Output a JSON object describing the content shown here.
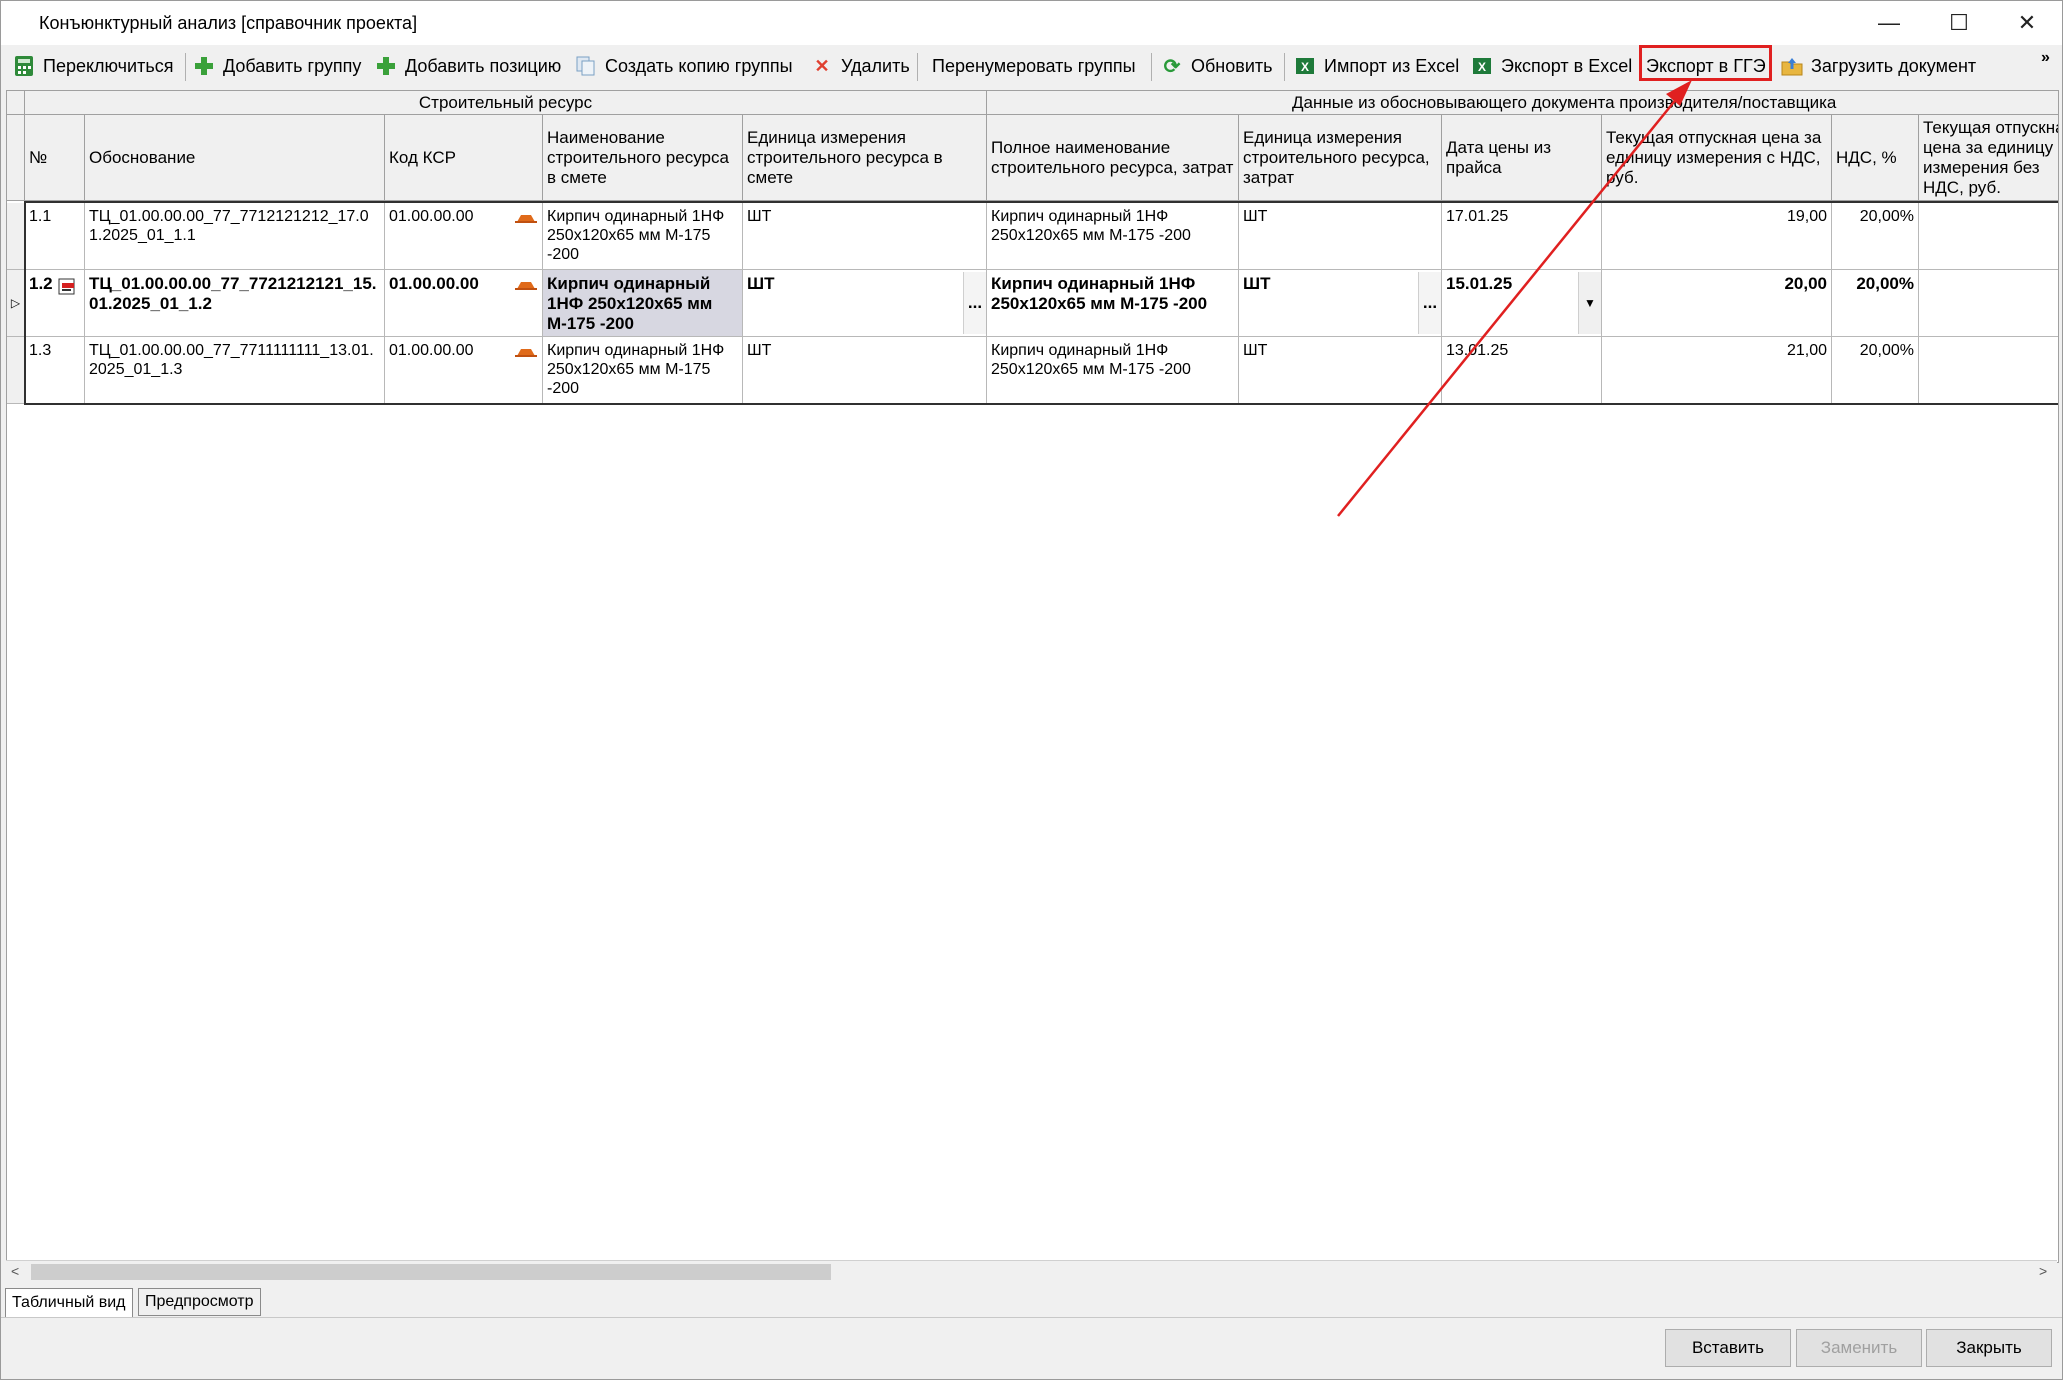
{
  "window": {
    "title": "Конъюнктурный анализ [справочник проекта]",
    "minimize": "—",
    "maximize": "☐",
    "close": "✕"
  },
  "toolbar": {
    "switch": "Переключиться",
    "add_group": "Добавить группу",
    "add_position": "Добавить позицию",
    "copy_group": "Создать копию группы",
    "delete": "Удалить",
    "renumber": "Перенумеровать группы",
    "refresh": "Обновить",
    "import_excel": "Импорт из Excel",
    "export_excel": "Экспорт в Excel",
    "export_gge": "Экспорт в ГГЭ",
    "load_document": "Загрузить документ",
    "more": "»",
    "highlight_color": "#e02020"
  },
  "grid": {
    "group_headers": {
      "resource": "Строительный ресурс",
      "supplier": "Данные из обосновывающего документа производителя/поставщика"
    },
    "columns": {
      "num": "№",
      "basis": "Обоснование",
      "ksr": "Код КСР",
      "name": "Наименование строительного ресурса в смете",
      "unit": "Единица измерения строительного ресурса в смете",
      "full_name": "Полное наименование строительного ресурса, затрат",
      "full_unit": "Единица измерения строительного ресурса, затрат",
      "price_date": "Дата цены из прайса",
      "price": "Текущая отпускная цена за единицу измерения с НДС, руб.",
      "vat": "НДС, %",
      "price2": "Текущая отпускная цена за единицу измерения без НДС, руб."
    },
    "rows": [
      {
        "num": "1.1",
        "basis": "ТЦ_01.00.00.00_77_7712121212_17.01.2025_01_1.1",
        "ksr": "01.00.00.00",
        "name": "Кирпич одинарный 1НФ 250х120х65 мм М-175 -200",
        "unit": "ШТ",
        "full_name": "Кирпич одинарный 1НФ 250х120х65 мм М-175 -200",
        "full_unit": "ШТ",
        "price_date": "17.01.25",
        "price": "19,00",
        "vat": "20,00%"
      },
      {
        "num": "1.2",
        "basis": "ТЦ_01.00.00.00_77_7721212121_15.01.2025_01_1.2",
        "ksr": "01.00.00.00",
        "name": "Кирпич одинарный 1НФ 250х120х65 мм М-175 -200",
        "unit": "ШТ",
        "full_name": "Кирпич одинарный 1НФ 250х120х65 мм М-175 -200",
        "full_unit": "ШТ",
        "price_date": "15.01.25",
        "price": "20,00",
        "vat": "20,00%"
      },
      {
        "num": "1.3",
        "basis": "ТЦ_01.00.00.00_77_7711111111_13.01.2025_01_1.3",
        "ksr": "01.00.00.00",
        "name": "Кирпич одинарный 1НФ 250х120х65 мм М-175 -200",
        "unit": "ШТ",
        "full_name": "Кирпич одинарный 1НФ 250х120х65 мм М-175 -200",
        "full_unit": "ШТ",
        "price_date": "13.01.25",
        "price": "21,00",
        "vat": "20,00%"
      }
    ],
    "ellipsis": "...",
    "dropdown": "▼",
    "row_pointer": "▷"
  },
  "tabs": {
    "table_view": "Табличный вид",
    "preview": "Предпросмотр"
  },
  "buttons": {
    "insert": "Вставить",
    "replace": "Заменить",
    "close": "Закрыть"
  }
}
